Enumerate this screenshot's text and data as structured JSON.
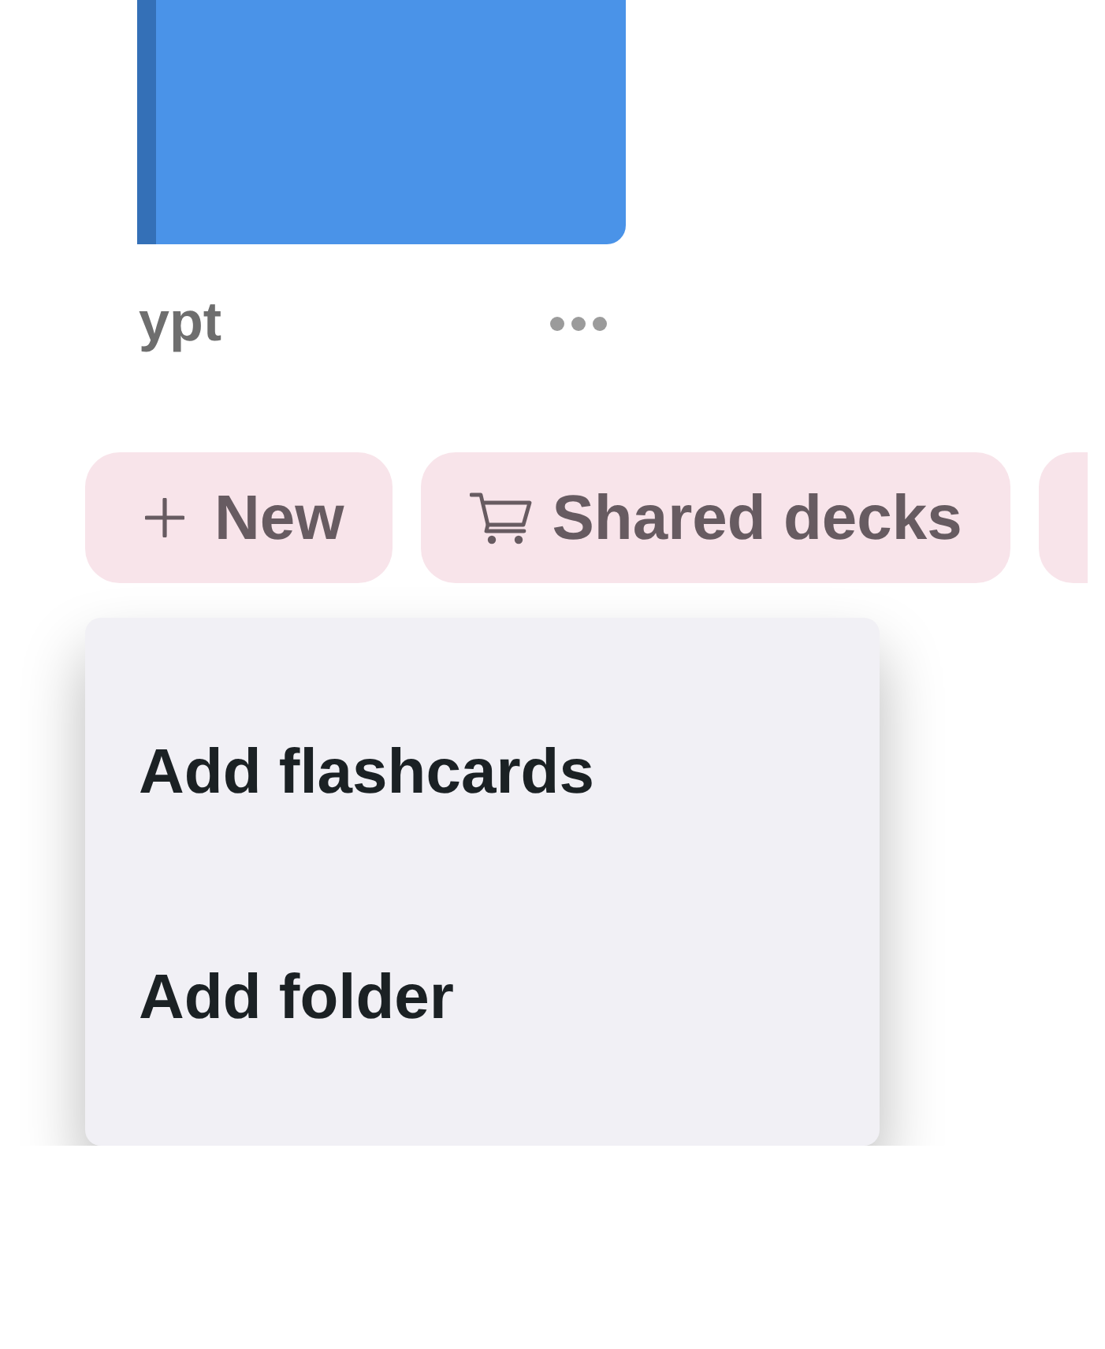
{
  "deck": {
    "name": "ypt"
  },
  "toolbar": [
    {
      "kind": "add",
      "label": "New"
    },
    {
      "kind": "shop",
      "label": "Shared decks"
    },
    {
      "kind": "cut"
    }
  ],
  "menu": {
    "items": [
      {
        "label": "Add flashcards"
      },
      {
        "label": "Add folder"
      }
    ]
  }
}
